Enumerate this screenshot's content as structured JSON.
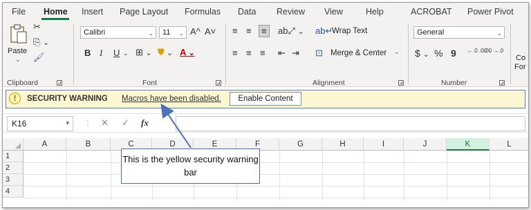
{
  "tabs": [
    "File",
    "Home",
    "Insert",
    "Page Layout",
    "Formulas",
    "Data",
    "Review",
    "View",
    "Help",
    "ACROBAT",
    "Power Pivot"
  ],
  "ribbon": {
    "clipboard": {
      "paste_label": "Paste",
      "group_label": "Clipboard"
    },
    "font": {
      "font_name": "Calibri",
      "font_size": "11",
      "bold": "B",
      "italic": "I",
      "underline": "U",
      "grow": "A^",
      "shrink": "A˅",
      "group_label": "Font"
    },
    "alignment": {
      "wrap_text": "Wrap Text",
      "merge_center": "Merge & Center",
      "group_label": "Alignment"
    },
    "number": {
      "format": "General",
      "currency": "$",
      "percent": "%",
      "comma": "9",
      "group_label": "Number",
      "inc_decimal": "←.0 .00",
      "dec_decimal": ".00 →.0"
    },
    "partial_label_1": "Co",
    "partial_label_2": "For"
  },
  "security_bar": {
    "title": "SECURITY WARNING",
    "message": "Macros have been disabled.",
    "button": "Enable Content",
    "icon": "warning-shield-icon",
    "background": "#fff7d1"
  },
  "formula_bar": {
    "name_box": "K16",
    "fx": "fx",
    "cancel": "✕",
    "enter": "✓"
  },
  "grid": {
    "columns": [
      "A",
      "B",
      "C",
      "D",
      "E",
      "F",
      "G",
      "H",
      "I",
      "J",
      "K",
      "L"
    ],
    "selected_column": "K",
    "rows": [
      "1",
      "2",
      "3",
      "4"
    ]
  },
  "callout": {
    "text": "This is the yellow security warning bar"
  }
}
